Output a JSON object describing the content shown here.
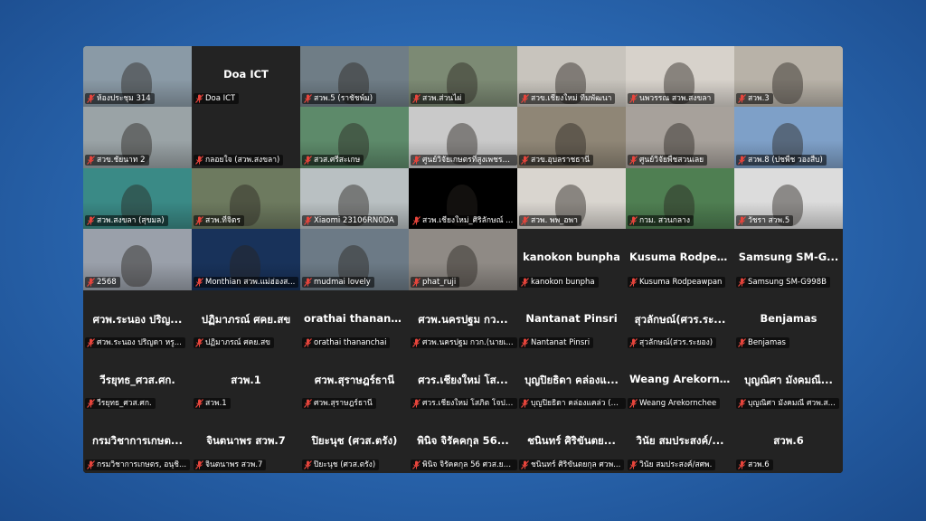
{
  "meeting": {
    "tiles": [
      {
        "label": "ห้องประชุม 314",
        "bg": "#8a9aa6",
        "active": true
      },
      {
        "label": "Doa ICT",
        "name": "Doa ICT",
        "bg": "#232323"
      },
      {
        "label": "สวพ.5 (ราชัชพ์ม)",
        "bg": "#6f7d86"
      },
      {
        "label": "สวพ.ส่วนไผ่",
        "bg": "#7c8a74"
      },
      {
        "label": "สวข.เชียงใหม่ ทีมพัฒนา",
        "bg": "#c8c4bd"
      },
      {
        "label": "นพวรรณ สวพ.สงขลา",
        "bg": "#d7d2cb"
      },
      {
        "label": "สวพ.3",
        "bg": "#b8b2a8"
      },
      {
        "label": "สวข.ชัยนาท 2",
        "bg": "#9aa3a6"
      },
      {
        "label": "กลอยใจ (สวพ.สงขลา)",
        "bg": "#232323"
      },
      {
        "label": "สวส.ศรีสะเกษ",
        "bg": "#5d8a6a"
      },
      {
        "label": "ศูนย์วิจัยเกษตรที่สูงเพชรบู...",
        "bg": "#c9c9c9"
      },
      {
        "label": "สวข.อุบลราชธานี",
        "bg": "#8f8676"
      },
      {
        "label": "ศูนย์วิจัยพืชสวนเลย",
        "bg": "#a7a19b"
      },
      {
        "label": "สวพ.8 (ปชพืช วองสืบ)",
        "bg": "#7ea0c8"
      },
      {
        "label": "สวพ.สงขลา (สุขมล)",
        "bg": "#3a8a86"
      },
      {
        "label": "สวพ.ที่จิตร",
        "bg": "#6d7a5f"
      },
      {
        "label": "Xiaomi 23106RN0DA",
        "bg": "#b9c0c2"
      },
      {
        "label": "สวพ.เชียงใหม่_ศิริลักษณ์ ...",
        "bg": "#000000"
      },
      {
        "label": "สวพ. พพ_อพา",
        "bg": "#d9d5cf"
      },
      {
        "label": "กวม. สวนกลาง",
        "bg": "#4f7f52"
      },
      {
        "label": "วัชรา สวพ.5",
        "bg": "#dcdcdc"
      },
      {
        "label": "2568",
        "bg": "#9aa0aa"
      },
      {
        "label": "Monthian สวพ.แม่ฮ่องส...",
        "bg": "#18325a"
      },
      {
        "label": "mudmai lovely",
        "bg": "#6c7a86"
      },
      {
        "label": "phat_ruji",
        "bg": "#8f8a85"
      },
      {
        "label": "kanokon bunpha",
        "name": "kanokon bunpha",
        "bg": "#232323"
      },
      {
        "label": "Kusuma Rodpeawpan",
        "name": "Kusuma  Rodpea...",
        "bg": "#232323"
      },
      {
        "label": "Samsung SM-G998B",
        "name": "Samsung  SM-G...",
        "bg": "#232323"
      },
      {
        "label": "ศวพ.ระนอง ปริญดา หรู...",
        "name": "ศวพ.ระนอง  ปริญ...",
        "bg": "#232323"
      },
      {
        "label": "ปฏิมาภรณ์ ศคย.สข",
        "name": "ปฏิมาภรณ์ ศคย.สข",
        "bg": "#232323"
      },
      {
        "label": "orathai thananchai",
        "name": "orathai  thananc...",
        "bg": "#232323"
      },
      {
        "label": "ศวพ.นครปฐม กวก.(นายเ...",
        "name": "ศวพ.นครปฐม กว...",
        "bg": "#232323"
      },
      {
        "label": "Nantanat Pinsri",
        "name": "Nantanat Pinsri",
        "bg": "#232323"
      },
      {
        "label": "สุวลักษณ์(สวร.ระยอง)",
        "name": "สุวลักษณ์(ศวร.ระ...",
        "bg": "#232323"
      },
      {
        "label": "Benjamas",
        "name": "Benjamas",
        "bg": "#232323"
      },
      {
        "label": "วีรยุทธ_ศวส.ศก.",
        "name": "วีรยุทธ_ศวส.ศก.",
        "bg": "#232323"
      },
      {
        "label": "สวพ.1",
        "name": "สวพ.1",
        "bg": "#232323"
      },
      {
        "label": "ศวพ.สุราษฎร์ธานี",
        "name": "ศวพ.สุราษฎร์ธานี",
        "bg": "#232323"
      },
      {
        "label": "ศวร.เชียงใหม่ โสภิต โจปาละ",
        "name": "ศวร.เชียงใหม่ โส...",
        "bg": "#232323"
      },
      {
        "label": "บุญปิยธิดา คล่องแคล่ว (ส...",
        "name": "บุญปิยธิดา คล่องแ...",
        "bg": "#232323"
      },
      {
        "label": "Weang Arekornchee",
        "name": "Weang  Arekorn...",
        "bg": "#232323"
      },
      {
        "label": "บุญณิศา มังคมณี ศวพ.ส...",
        "name": "บุญณิศา มังคมณี...",
        "bg": "#232323"
      },
      {
        "label": "กรมวิชาการเกษตร, อนุชิ...",
        "name": "กรมวิชาการเกษต...",
        "bg": "#232323"
      },
      {
        "label": "จินตนาพร สวพ.7",
        "name": "จินตนาพร  สวพ.7",
        "bg": "#232323"
      },
      {
        "label": "ปิยะนุช (ศวส.ตรัง)",
        "name": "ปิยะนุช  (ศวส.ตรัง)",
        "bg": "#232323"
      },
      {
        "label": "พินิจ จิรัคคกุล 56 ศวส.ยก...",
        "name": "พินิจ จิรัคคกุล 56...",
        "bg": "#232323"
      },
      {
        "label": "ชนินทร์ ศิริขันตยกุล ศวพ...",
        "name": "ชนินทร์ ศิริขันตย...",
        "bg": "#232323"
      },
      {
        "label": "วินัย สมประสงค์/สศพ.",
        "name": "วินัย  สมประสงค์/...",
        "bg": "#232323"
      },
      {
        "label": "สวพ.6",
        "name": "สวพ.6",
        "bg": "#232323"
      }
    ],
    "colors": {
      "muted_icon": "#e8453c",
      "active_border": "#3ddc84"
    }
  }
}
